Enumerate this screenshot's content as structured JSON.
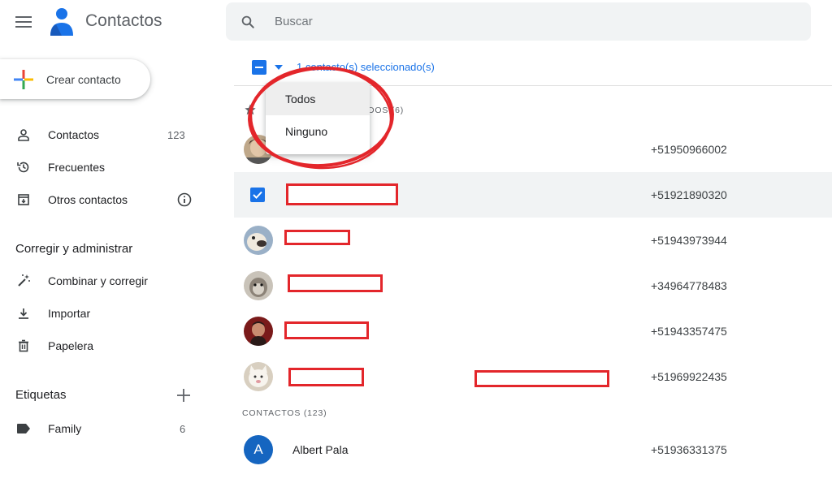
{
  "header": {
    "app_title": "Contactos",
    "search_placeholder": "Buscar"
  },
  "sidebar": {
    "create_label": "Crear contacto",
    "items": [
      {
        "label": "Contactos",
        "count": "123",
        "icon": "person-icon"
      },
      {
        "label": "Frecuentes",
        "icon": "history-icon"
      },
      {
        "label": "Otros contactos",
        "icon": "archive-icon"
      }
    ],
    "manage_title": "Corregir y administrar",
    "manage_items": [
      {
        "label": "Combinar y corregir",
        "icon": "magic-wand-icon"
      },
      {
        "label": "Importar",
        "icon": "download-icon"
      },
      {
        "label": "Papelera",
        "icon": "trash-icon"
      }
    ],
    "labels_title": "Etiquetas",
    "labels": [
      {
        "label": "Family",
        "count": "6",
        "icon": "label-icon"
      }
    ]
  },
  "selection": {
    "text": "1 contacto(s) seleccionado(s)"
  },
  "dropdown": {
    "options": [
      "Todos",
      "Ninguno"
    ]
  },
  "groups": {
    "starred_header_visible": "DOS (6)",
    "contacts_header": "CONTACTOS (123)"
  },
  "starred_rows": [
    {
      "phone": "+51950966002",
      "selected": false
    },
    {
      "phone": "+51921890320",
      "selected": true
    },
    {
      "phone": "+51943973944",
      "selected": false
    },
    {
      "phone": "+34964778483",
      "selected": false
    },
    {
      "phone": "+51943357475",
      "selected": false
    },
    {
      "phone": "+51969922435",
      "selected": false
    }
  ],
  "contacts_rows": [
    {
      "initial": "A",
      "name": "Albert Pala",
      "phone": "+51936331375"
    }
  ],
  "colors": {
    "accent": "#1a73e8",
    "annotation_red": "#e3262b",
    "avatar_blue": "#1565c0"
  }
}
